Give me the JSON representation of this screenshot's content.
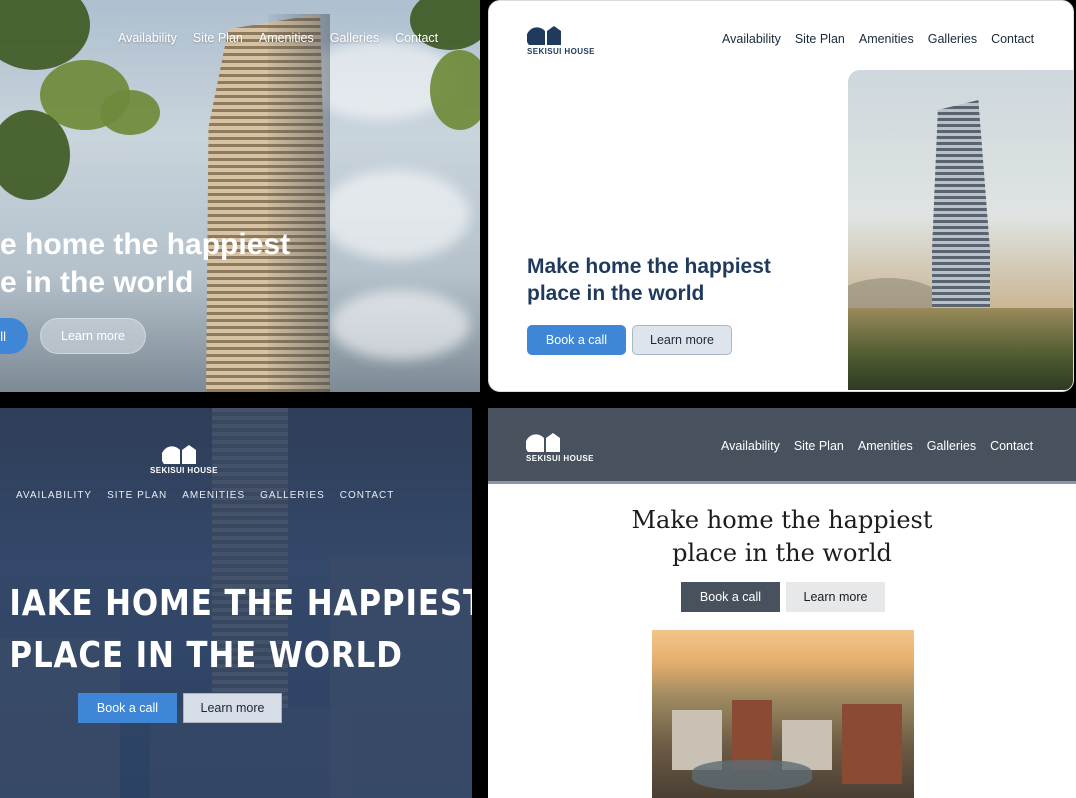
{
  "brand": {
    "name": "SEKISUI HOUSE"
  },
  "nav": {
    "items": [
      "Availability",
      "Site Plan",
      "Amenities",
      "Galleries",
      "Contact"
    ],
    "items_caps": [
      "AVAILABILITY",
      "SITE PLAN",
      "AMENITIES",
      "GALLERIES",
      "CONTACT"
    ]
  },
  "hero": {
    "line1": "Make home the happiest",
    "line2": "place in the world",
    "line1_caps": "MAKE HOME THE HAPPIEST",
    "line2_caps": "PLACE IN THE WORLD",
    "p1_line1_visible": "e home the happiest",
    "p1_line2_visible": "e in the world",
    "p1_primary_visible": "ll",
    "p3_line1_visible": "IAKE HOME THE HAPPIEST"
  },
  "buttons": {
    "primary": "Book a call",
    "secondary": "Learn more"
  },
  "colors": {
    "accent_blue": "#3f86d7",
    "navy_text": "#1f3a5c",
    "slate_header": "#47525e",
    "dark_overlay": "#2f3e58"
  }
}
